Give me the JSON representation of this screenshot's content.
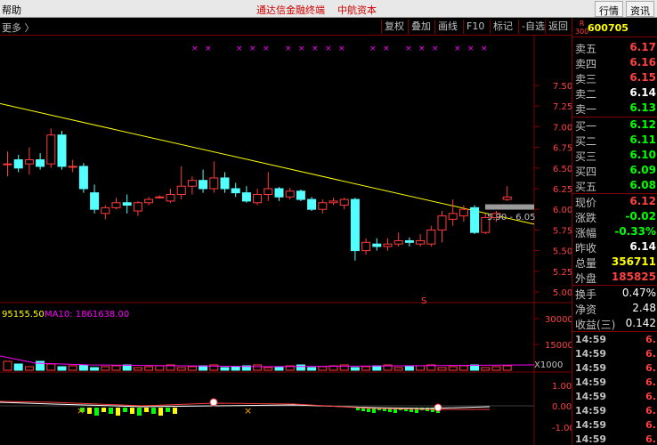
{
  "topbar": {
    "help": "帮助",
    "title": "通达信金融终端    中航资本",
    "quote_btn": "行情",
    "news_btn": "资讯"
  },
  "toolbar": {
    "more": "更多 〉",
    "buttons": [
      "复权",
      "叠加",
      "画线",
      "F10",
      "标记",
      "-自选",
      "返回"
    ]
  },
  "stock": {
    "badge_top": "R",
    "badge_bottom": "300",
    "code": "600705"
  },
  "order_book": {
    "sell": [
      {
        "label": "卖五",
        "price": "6.17"
      },
      {
        "label": "卖四",
        "price": "6.16"
      },
      {
        "label": "卖三",
        "price": "6.15"
      },
      {
        "label": "卖二",
        "price": "6.14"
      },
      {
        "label": "卖一",
        "price": "6.13"
      }
    ],
    "buy": [
      {
        "label": "买一",
        "price": "6.12"
      },
      {
        "label": "买二",
        "price": "6.11"
      },
      {
        "label": "买三",
        "price": "6.10"
      },
      {
        "label": "买四",
        "price": "6.09"
      },
      {
        "label": "买五",
        "price": "6.08"
      }
    ]
  },
  "quote": [
    {
      "label": "现价",
      "value": "6.12",
      "color": "#ff4040"
    },
    {
      "label": "涨跌",
      "value": "-0.02",
      "color": "#00ff00"
    },
    {
      "label": "涨幅",
      "value": "-0.33%",
      "color": "#00ff00"
    },
    {
      "label": "昨收",
      "value": "6.14",
      "color": "#ffffff"
    },
    {
      "label": "总量",
      "value": "356711",
      "color": "#ffff00"
    },
    {
      "label": "外盘",
      "value": "185825",
      "color": "#ff4040"
    }
  ],
  "stats": [
    {
      "label": "换手",
      "value": "0.47%"
    },
    {
      "label": "净资",
      "value": "2.48"
    },
    {
      "label": "收益(三)",
      "value": "0.142"
    }
  ],
  "ticks": [
    {
      "time": "14:59",
      "price": "6."
    },
    {
      "time": "14:59",
      "price": "6."
    },
    {
      "time": "14:59",
      "price": "6."
    },
    {
      "time": "14:59",
      "price": "6."
    },
    {
      "time": "14:59",
      "price": "6."
    },
    {
      "time": "14:59",
      "price": "6."
    },
    {
      "time": "14:59",
      "price": "6."
    },
    {
      "time": "14:59",
      "price": "6."
    }
  ],
  "chart": {
    "price_axis": [
      "7.50",
      "7.25",
      "7.00",
      "6.75",
      "6.50",
      "6.25",
      "6.00",
      "5.75",
      "5.50",
      "5.25",
      "5.00"
    ],
    "price_range": [
      5.0,
      7.5
    ],
    "range_label": "5.90 - 6.05",
    "marker_s": "S",
    "volume_label_vol": "95155.50",
    "volume_label_ma": "MA10: 1861638.00",
    "volume_axis": [
      "30000",
      "15000"
    ],
    "volume_unit": "X1000",
    "indicator_axis": [
      "1.00",
      "0.00",
      "-1.00"
    ],
    "colors": {
      "up": "#ff3c3c",
      "down": "#54ffff",
      "trend": "#ffff00",
      "ma": "#ff00ff"
    },
    "candles": [
      {
        "o": 6.55,
        "h": 6.7,
        "l": 6.4,
        "c": 6.55
      },
      {
        "o": 6.6,
        "h": 6.66,
        "l": 6.45,
        "c": 6.5
      },
      {
        "o": 6.55,
        "h": 6.75,
        "l": 6.42,
        "c": 6.6
      },
      {
        "o": 6.6,
        "h": 6.68,
        "l": 6.48,
        "c": 6.52
      },
      {
        "o": 6.55,
        "h": 6.98,
        "l": 6.5,
        "c": 6.9
      },
      {
        "o": 6.9,
        "h": 6.95,
        "l": 6.48,
        "c": 6.52
      },
      {
        "o": 6.52,
        "h": 6.6,
        "l": 6.45,
        "c": 6.52
      },
      {
        "o": 6.52,
        "h": 6.56,
        "l": 6.2,
        "c": 6.25
      },
      {
        "o": 6.2,
        "h": 6.3,
        "l": 5.95,
        "c": 6.0
      },
      {
        "o": 5.95,
        "h": 6.05,
        "l": 5.88,
        "c": 6.02
      },
      {
        "o": 6.02,
        "h": 6.14,
        "l": 6.0,
        "c": 6.08
      },
      {
        "o": 6.08,
        "h": 6.18,
        "l": 5.95,
        "c": 6.05
      },
      {
        "o": 5.98,
        "h": 6.1,
        "l": 5.92,
        "c": 6.08
      },
      {
        "o": 6.08,
        "h": 6.15,
        "l": 6.05,
        "c": 6.12
      },
      {
        "o": 6.15,
        "h": 6.17,
        "l": 6.13,
        "c": 6.15
      },
      {
        "o": 6.1,
        "h": 6.25,
        "l": 6.08,
        "c": 6.18
      },
      {
        "o": 6.18,
        "h": 6.52,
        "l": 6.12,
        "c": 6.28
      },
      {
        "o": 6.28,
        "h": 6.4,
        "l": 6.18,
        "c": 6.35
      },
      {
        "o": 6.35,
        "h": 6.48,
        "l": 6.2,
        "c": 6.25
      },
      {
        "o": 6.25,
        "h": 6.58,
        "l": 6.2,
        "c": 6.38
      },
      {
        "o": 6.38,
        "h": 6.45,
        "l": 6.2,
        "c": 6.25
      },
      {
        "o": 6.25,
        "h": 6.32,
        "l": 6.15,
        "c": 6.2
      },
      {
        "o": 6.2,
        "h": 6.28,
        "l": 6.08,
        "c": 6.1
      },
      {
        "o": 6.08,
        "h": 6.25,
        "l": 6.05,
        "c": 6.18
      },
      {
        "o": 6.18,
        "h": 6.45,
        "l": 6.1,
        "c": 6.25
      },
      {
        "o": 6.25,
        "h": 6.27,
        "l": 6.1,
        "c": 6.15
      },
      {
        "o": 6.15,
        "h": 6.26,
        "l": 6.12,
        "c": 6.22
      },
      {
        "o": 6.22,
        "h": 6.24,
        "l": 6.1,
        "c": 6.12
      },
      {
        "o": 6.12,
        "h": 6.15,
        "l": 5.98,
        "c": 6.0
      },
      {
        "o": 6.0,
        "h": 6.12,
        "l": 5.95,
        "c": 6.08
      },
      {
        "o": 6.08,
        "h": 6.14,
        "l": 6.05,
        "c": 6.1
      },
      {
        "o": 6.05,
        "h": 6.14,
        "l": 6.0,
        "c": 6.12
      },
      {
        "o": 6.12,
        "h": 6.14,
        "l": 5.38,
        "c": 5.5
      },
      {
        "o": 5.5,
        "h": 5.65,
        "l": 5.45,
        "c": 5.6
      },
      {
        "o": 5.58,
        "h": 5.65,
        "l": 5.5,
        "c": 5.55
      },
      {
        "o": 5.55,
        "h": 5.65,
        "l": 5.5,
        "c": 5.58
      },
      {
        "o": 5.58,
        "h": 5.72,
        "l": 5.55,
        "c": 5.62
      },
      {
        "o": 5.62,
        "h": 5.66,
        "l": 5.55,
        "c": 5.6
      },
      {
        "o": 5.58,
        "h": 5.7,
        "l": 5.55,
        "c": 5.62
      },
      {
        "o": 5.58,
        "h": 5.8,
        "l": 5.55,
        "c": 5.75
      },
      {
        "o": 5.75,
        "h": 5.98,
        "l": 5.6,
        "c": 5.92
      },
      {
        "o": 5.88,
        "h": 6.12,
        "l": 5.8,
        "c": 5.95
      },
      {
        "o": 5.92,
        "h": 6.05,
        "l": 5.85,
        "c": 6.0
      },
      {
        "o": 6.02,
        "h": 6.05,
        "l": 5.7,
        "c": 5.72
      },
      {
        "o": 5.72,
        "h": 5.95,
        "l": 5.7,
        "c": 5.9
      },
      {
        "o": 5.9,
        "h": 5.98,
        "l": 5.85,
        "c": 5.95
      },
      {
        "o": 6.12,
        "h": 6.28,
        "l": 6.1,
        "c": 6.15
      }
    ]
  }
}
